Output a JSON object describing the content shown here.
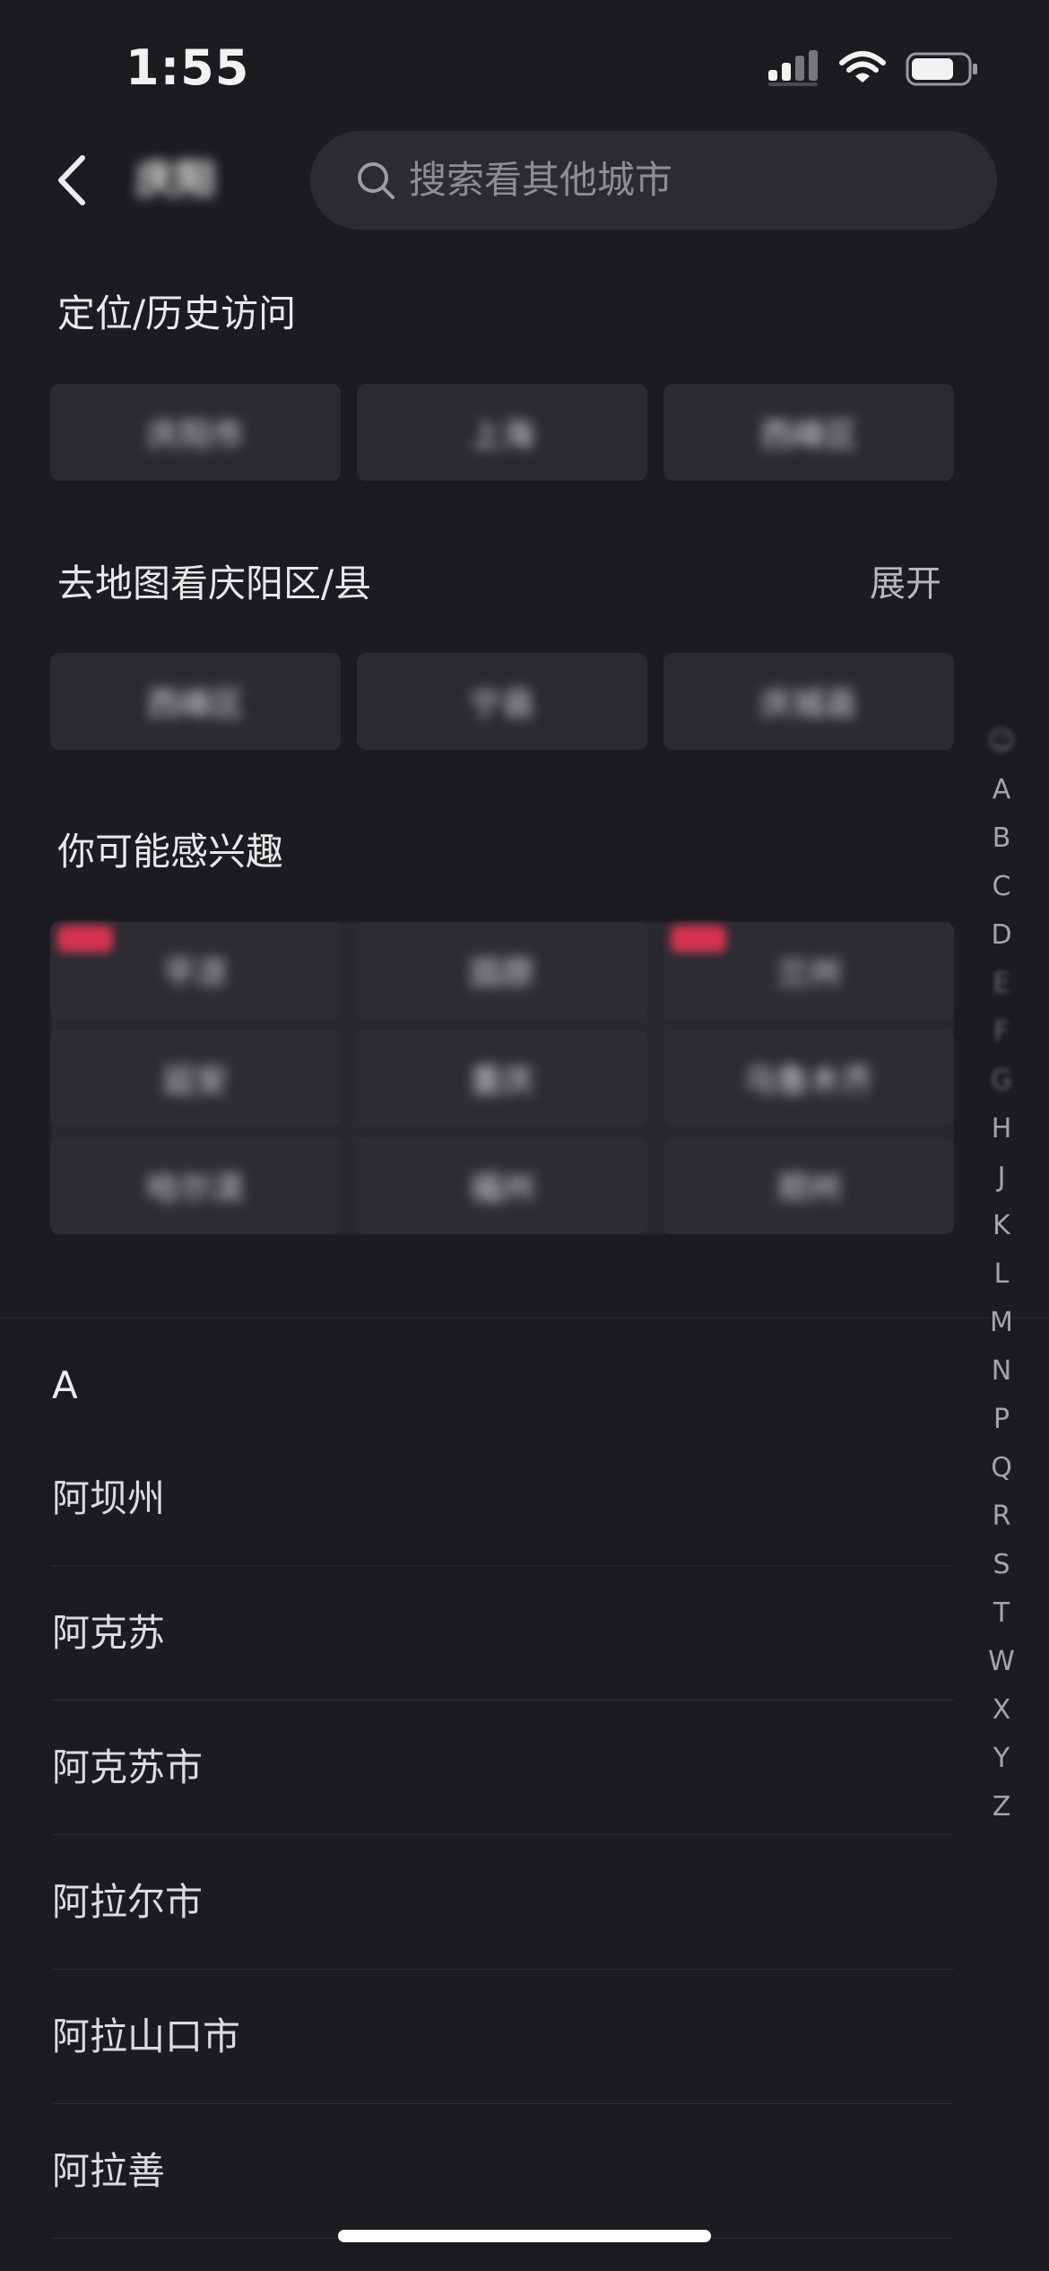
{
  "status_bar": {
    "time": "1:55"
  },
  "header": {
    "city_name": "庆阳",
    "search_placeholder": "搜索看其他城市"
  },
  "section_location": {
    "title": "定位/历史访问",
    "chips": [
      "庆阳市",
      "上海",
      "西峰区"
    ]
  },
  "section_districts": {
    "title": "去地图看庆阳区/县",
    "expand_label": "展开",
    "chips": [
      "西峰区",
      "宁县",
      "庆城县"
    ]
  },
  "section_interest": {
    "title": "你可能感兴趣",
    "rows": [
      [
        "平凉",
        "固原",
        "兰州"
      ],
      [
        "延安",
        "重庆",
        "乌鲁木齐"
      ],
      [
        "哈尔滨",
        "福州",
        "郑州"
      ]
    ]
  },
  "letter_index": [
    "☺",
    "A",
    "B",
    "C",
    "D",
    "E",
    "F",
    "G",
    "H",
    "J",
    "K",
    "L",
    "M",
    "N",
    "P",
    "Q",
    "R",
    "S",
    "T",
    "W",
    "X",
    "Y",
    "Z"
  ],
  "city_list": {
    "header": "A",
    "items": [
      "阿坝州",
      "阿克苏",
      "阿克苏市",
      "阿拉尔市",
      "阿拉山口市",
      "阿拉善"
    ]
  }
}
